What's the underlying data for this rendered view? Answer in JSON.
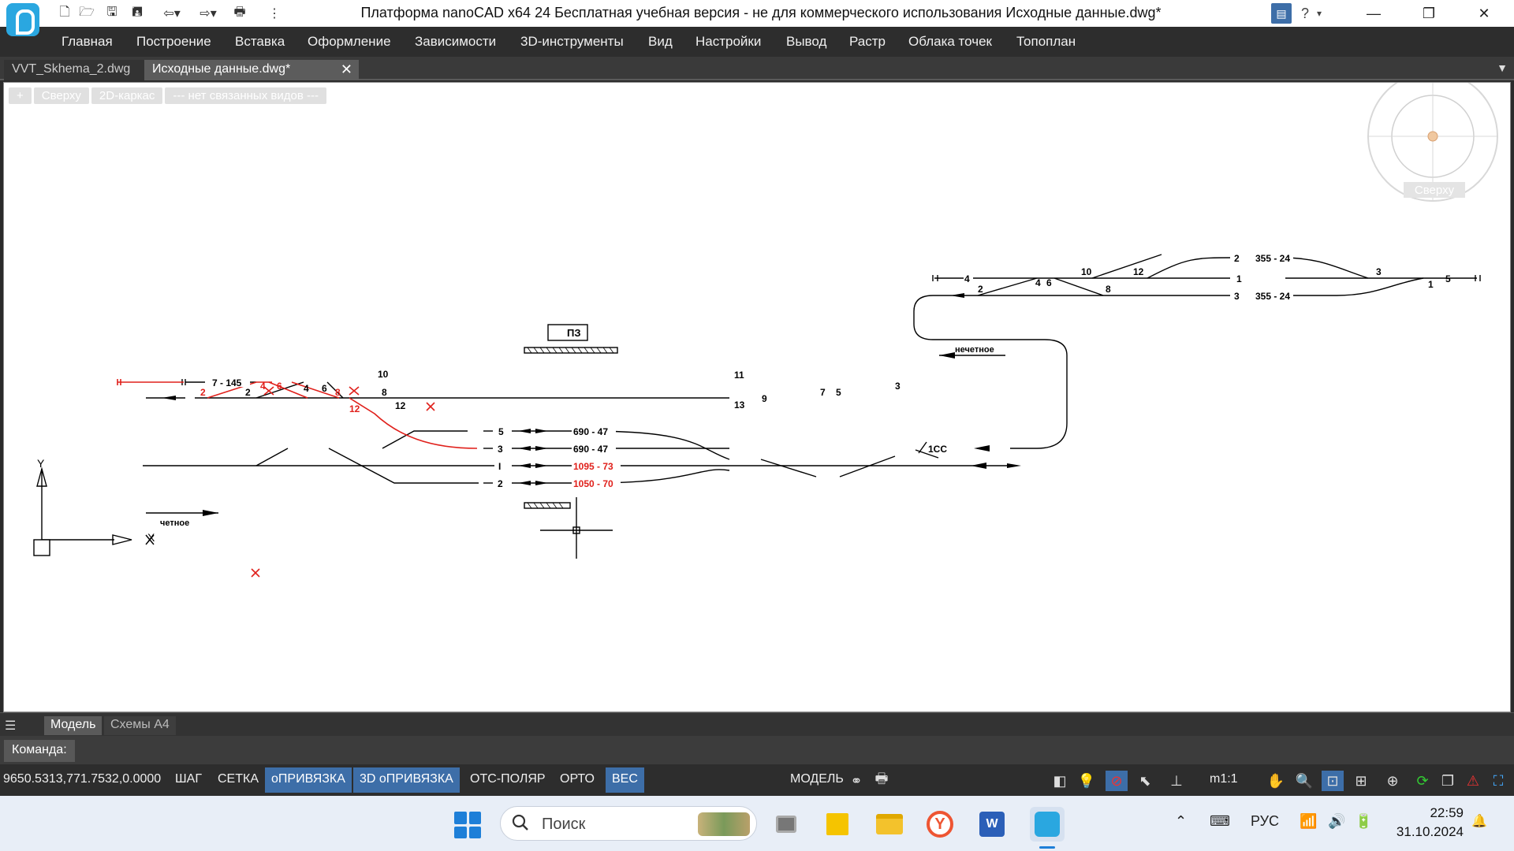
{
  "window": {
    "title": "Платформа nanoCAD x64 24  Бесплатная учебная версия - не для коммерческого использования Исходные данные.dwg*",
    "help_label": "?",
    "quick_access_icons": [
      "new-file-icon",
      "open-folder-icon",
      "save-icon",
      "save-as-icon",
      "undo-icon",
      "redo-icon",
      "print-icon",
      "customize-icon"
    ]
  },
  "menu": {
    "items": [
      "Главная",
      "Построение",
      "Вставка",
      "Оформление",
      "Зависимости",
      "3D-инструменты",
      "Вид",
      "Настройки",
      "Вывод",
      "Растр",
      "Облака точек",
      "Топоплан"
    ]
  },
  "doc_tabs": {
    "items": [
      {
        "label": "VVT_Skhema_2.dwg",
        "active": false
      },
      {
        "label": "Исходные данные.dwg*",
        "active": true
      }
    ],
    "close_symbol": "✕",
    "overflow_symbol": "▼"
  },
  "viewport": {
    "controls": [
      "+",
      "Сверху",
      "2D-каркас",
      "--- нет связанных видов ---"
    ],
    "viewcube_label": "Сверху",
    "ucs_x": "X",
    "ucs_y": "Y"
  },
  "drawing": {
    "colors": {
      "main": "#000000",
      "red": "#e0201b"
    },
    "pz_label": "ПЗ",
    "direction_even": "четное",
    "direction_odd": "нечетное",
    "track_labels": {
      "t5": "5",
      "t3": "3",
      "tI": "I",
      "t2": "2",
      "v5": "690 - 47",
      "v3": "690 - 47",
      "vI": "1095 - 73",
      "v2": "1050 - 70",
      "left_track": "7 - 145",
      "top4": "4",
      "top1": "1",
      "top3": "3",
      "top2": "2",
      "v_top2": "355 - 24",
      "v_top3": "355 - 24",
      "s5_right": "5",
      "s1cc": "1СС"
    },
    "switch_numbers": {
      "l2_red": "2",
      "l2": "2",
      "l4_red": "4",
      "l6_red": "6",
      "l4": "4",
      "l6": "6",
      "l8_red": "8",
      "l8": "8",
      "l10": "10",
      "l12_red": "12",
      "l12": "12",
      "m11": "11",
      "m13": "13",
      "m9": "9",
      "m7": "7",
      "m5": "5",
      "m3": "3",
      "t2": "2",
      "t4": "4",
      "t6": "6",
      "t10": "10",
      "t12": "12",
      "t8": "8",
      "t3": "3",
      "t1": "1"
    }
  },
  "layout_tabs": {
    "items": [
      "Модель",
      "Схемы А4"
    ]
  },
  "command": {
    "label": "Команда:"
  },
  "status": {
    "coords": "9650.5313,771.7532,0.0000",
    "toggles": [
      {
        "label": "ШАГ",
        "on": false
      },
      {
        "label": "СЕТКА",
        "on": false
      },
      {
        "label": "оПРИВЯЗКА",
        "on": true
      },
      {
        "label": "3D оПРИВЯЗКА",
        "on": true
      },
      {
        "label": "ОТС-ПОЛЯР",
        "on": false
      },
      {
        "label": "ОРТО",
        "on": false
      },
      {
        "label": "ВЕС",
        "on": true
      }
    ],
    "model_label": "МОДЕЛЬ",
    "scale": "m1:1"
  },
  "taskbar": {
    "search_placeholder": "Поиск",
    "language": "РУС",
    "time": "22:59",
    "date": "31.10.2024"
  }
}
